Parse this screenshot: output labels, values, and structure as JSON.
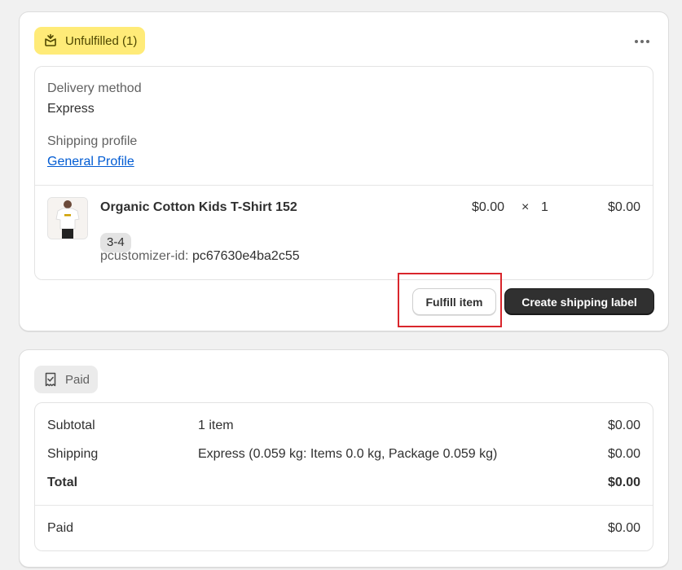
{
  "fulfillment": {
    "badge_label": "Unfulfilled (1)",
    "delivery_method_label": "Delivery method",
    "delivery_method_value": "Express",
    "shipping_profile_label": "Shipping profile",
    "shipping_profile_link": "General Profile",
    "item": {
      "name": "Organic Cotton Kids T-Shirt 152",
      "variant": "3-4",
      "property_label": "pcustomizer-id:",
      "property_value": "pc67630e4ba2c55",
      "price": "$0.00",
      "times": "×",
      "quantity": "1",
      "total": "$0.00"
    },
    "fulfill_button": "Fulfill item",
    "shipping_label_button": "Create shipping label"
  },
  "payment": {
    "badge_label": "Paid",
    "rows": [
      {
        "label": "Subtotal",
        "detail": "1 item",
        "amount": "$0.00"
      },
      {
        "label": "Shipping",
        "detail": "Express (0.059 kg: Items 0.0 kg, Package 0.059 kg)",
        "amount": "$0.00"
      },
      {
        "label": "Total",
        "detail": "",
        "amount": "$0.00"
      }
    ],
    "paid_label": "Paid",
    "paid_amount": "$0.00"
  },
  "colors": {
    "unfulfilled_badge": "#ffeb78",
    "paid_badge": "#ebebeb",
    "primary_button": "#303030",
    "link": "#005bd3",
    "highlight": "#d9262c"
  }
}
